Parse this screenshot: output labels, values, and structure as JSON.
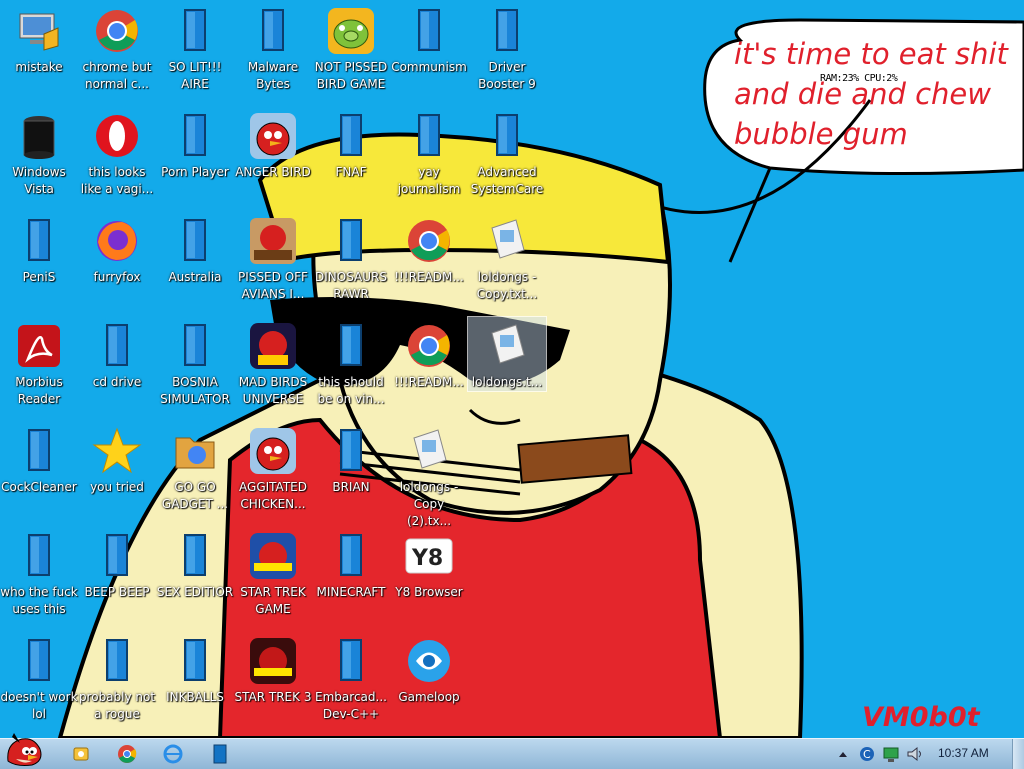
{
  "desktop": {
    "icons": [
      {
        "label": "mistake",
        "type": "computer"
      },
      {
        "label": "chrome but normal c...",
        "type": "chrome"
      },
      {
        "label": "SO LIT!!! AIRE",
        "type": "blank"
      },
      {
        "label": "Malware Bytes",
        "type": "blank"
      },
      {
        "label": "NOT PISSED BIRD GAME",
        "type": "pig"
      },
      {
        "label": "Communism",
        "type": "blank"
      },
      {
        "label": "Driver Booster 9",
        "type": "blank"
      },
      {
        "label": "Windows Vista",
        "type": "trash"
      },
      {
        "label": "this looks like a vagi...",
        "type": "opera"
      },
      {
        "label": "Porn Player",
        "type": "blank"
      },
      {
        "label": "ANGER BIRD",
        "type": "angrybird"
      },
      {
        "label": "FNAF",
        "type": "blank"
      },
      {
        "label": "yay journalism",
        "type": "blank"
      },
      {
        "label": "Advanced SystemCare",
        "type": "blank"
      },
      {
        "label": "PeniS",
        "type": "blank"
      },
      {
        "label": "furryfox",
        "type": "firefox"
      },
      {
        "label": "Australia",
        "type": "blank"
      },
      {
        "label": "PISSED OFF AVIANS I...",
        "type": "seasons"
      },
      {
        "label": "DINOSAURS RAWR",
        "type": "blank"
      },
      {
        "label": "!!!READM...",
        "type": "chrome"
      },
      {
        "label": "loldongs - Copy.txt...",
        "type": "notepad"
      },
      {
        "label": "Morbius Reader",
        "type": "acrobat"
      },
      {
        "label": "cd drive",
        "type": "blank"
      },
      {
        "label": "BOSNIA SIMULATOR",
        "type": "blank"
      },
      {
        "label": "MAD BIRDS UNIVERSE",
        "type": "space"
      },
      {
        "label": "this should be on vin...",
        "type": "blank"
      },
      {
        "label": "!!!READM...",
        "type": "chrome"
      },
      {
        "label": "loldongs.t...",
        "type": "notepad"
      },
      {
        "label": "CockCleaner",
        "type": "blank"
      },
      {
        "label": "you tried",
        "type": "star"
      },
      {
        "label": "GO GO GADGET ...",
        "type": "folder"
      },
      {
        "label": "AGGITATED CHICKEN...",
        "type": "angrybird"
      },
      {
        "label": "BRIAN",
        "type": "blank"
      },
      {
        "label": "loldongs - Copy (2).tx...",
        "type": "notepad"
      },
      {
        "label": "who the fuck uses this",
        "type": "blank"
      },
      {
        "label": "BEEP BEEP",
        "type": "blank"
      },
      {
        "label": "SEX EDITIOR",
        "type": "blank"
      },
      {
        "label": "STAR TREK GAME",
        "type": "starwars"
      },
      {
        "label": "MINECRAFT",
        "type": "blank"
      },
      {
        "label": "Y8 Browser",
        "type": "y8"
      },
      {
        "label": "doesn't work lol",
        "type": "blank"
      },
      {
        "label": "probably not a rogue",
        "type": "blank"
      },
      {
        "label": "INKBALLS",
        "type": "blank"
      },
      {
        "label": "STAR TREK 3",
        "type": "starwars2"
      },
      {
        "label": "Embarcad... Dev-C++",
        "type": "blank"
      },
      {
        "label": "Gameloop",
        "type": "gameloop"
      }
    ]
  },
  "wallpaper": {
    "speech_lines": [
      "it's time to eat shit",
      "and die and chew",
      "bubble gum"
    ],
    "signature": "VM0b0t",
    "colors": {
      "sky": "#13aaea",
      "skin": "#f7f0b8",
      "hat": "#f7e83a",
      "shirt": "#e4262c",
      "text": "#e0202c"
    }
  },
  "system_monitor": "RAM:23% CPU:2%",
  "taskbar": {
    "start_icon": "angry-bird-start-icon",
    "pinned": [
      "explorer-icon",
      "chrome-icon",
      "ie-icon",
      "blank-app-icon"
    ],
    "tray_icons": [
      "tray-arrow-icon",
      "ccleaner-icon",
      "network-icon",
      "volume-icon"
    ],
    "clock": "10:37 AM"
  }
}
